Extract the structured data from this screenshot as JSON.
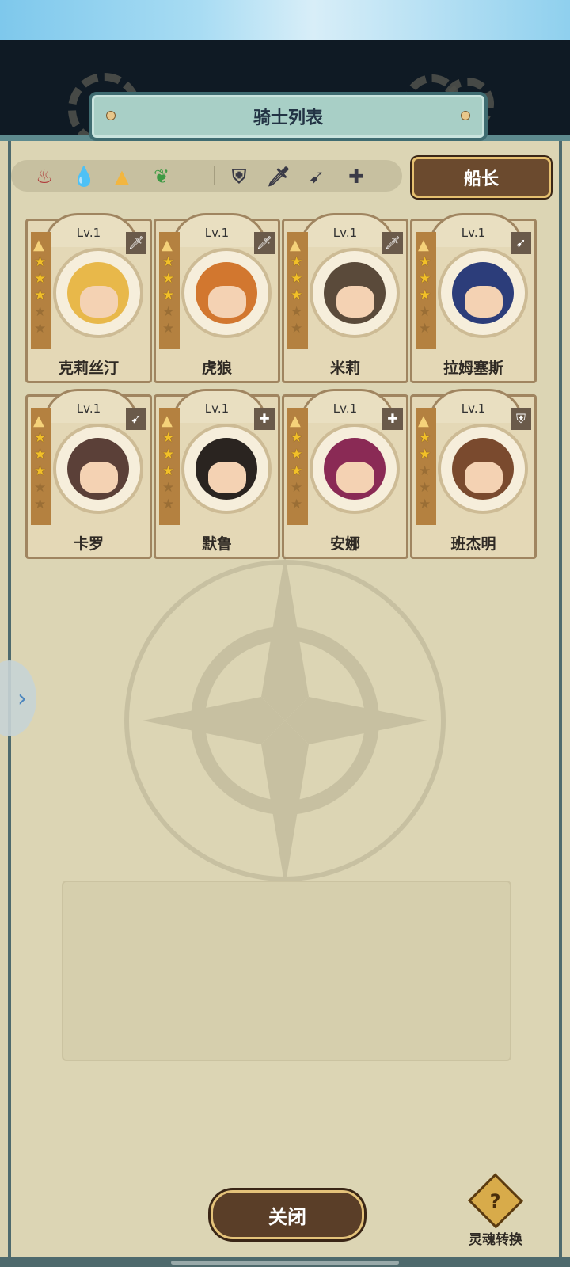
{
  "header": {
    "title": "骑士列表"
  },
  "filters": {
    "elements": [
      {
        "icon": "fire-icon",
        "glyph": "♨",
        "color": "#b03a3a"
      },
      {
        "icon": "water-icon",
        "glyph": "💧",
        "color": "#3a6fc0"
      },
      {
        "icon": "earth-icon",
        "glyph": "▲",
        "color": "#f2b640"
      },
      {
        "icon": "wind-icon",
        "glyph": "❦",
        "color": "#3e9a44"
      }
    ],
    "roles": [
      {
        "icon": "tank-shield-icon",
        "glyph": "⛨"
      },
      {
        "icon": "sword-icon",
        "glyph": "🗡"
      },
      {
        "icon": "bow-icon",
        "glyph": "➹"
      },
      {
        "icon": "healer-cross-icon",
        "glyph": "✚"
      }
    ]
  },
  "captain_button": {
    "label": "船长"
  },
  "knights": [
    {
      "name": "克莉丝汀",
      "level": "Lv.1",
      "stars": 3,
      "role_icon": "sword-icon",
      "role_glyph": "🗡",
      "hair": "#e8b84a"
    },
    {
      "name": "虎狼",
      "level": "Lv.1",
      "stars": 3,
      "role_icon": "sword-icon",
      "role_glyph": "🗡",
      "hair": "#d2772f"
    },
    {
      "name": "米莉",
      "level": "Lv.1",
      "stars": 3,
      "role_icon": "sword-icon",
      "role_glyph": "🗡",
      "hair": "#5a4a3a"
    },
    {
      "name": "拉姆塞斯",
      "level": "Lv.1",
      "stars": 3,
      "role_icon": "bow-icon",
      "role_glyph": "➹",
      "hair": "#2c3d7a"
    },
    {
      "name": "卡罗",
      "level": "Lv.1",
      "stars": 3,
      "role_icon": "bow-icon",
      "role_glyph": "➹",
      "hair": "#5b4038"
    },
    {
      "name": "默鲁",
      "level": "Lv.1",
      "stars": 3,
      "role_icon": "healer-cross-icon",
      "role_glyph": "✚",
      "hair": "#2a2420"
    },
    {
      "name": "安娜",
      "level": "Lv.1",
      "stars": 3,
      "role_icon": "healer-cross-icon",
      "role_glyph": "✚",
      "hair": "#8a2a55"
    },
    {
      "name": "班杰明",
      "level": "Lv.1",
      "stars": 2,
      "role_icon": "tank-shield-icon",
      "role_glyph": "⛨",
      "hair": "#7a4a2e"
    }
  ],
  "side_tab": {
    "glyph": "›"
  },
  "close_button": {
    "label": "关闭"
  },
  "soul_convert": {
    "label": "灵魂转换",
    "glyph": "?"
  }
}
